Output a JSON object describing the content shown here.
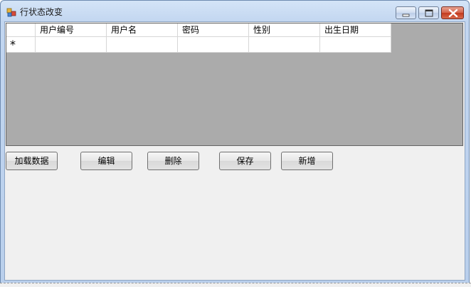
{
  "window": {
    "title": "行状态改变",
    "icon": "winforms-app-icon",
    "controls": {
      "minimize_icon": "minimize-icon",
      "maximize_icon": "maximize-icon",
      "close_icon": "close-icon"
    }
  },
  "grid": {
    "columns": [
      "用户编号",
      "用户名",
      "密码",
      "性别",
      "出生日期"
    ],
    "new_row_marker": "*",
    "rows": [
      [
        "",
        "",
        "",
        "",
        ""
      ]
    ]
  },
  "buttons": {
    "load": "加载数据",
    "edit": "编辑",
    "delete": "删除",
    "save": "保存",
    "add": "新增"
  },
  "colors": {
    "grid_background": "#ababab",
    "client_background": "#f0f0f0",
    "close_button": "#c23a1f"
  }
}
